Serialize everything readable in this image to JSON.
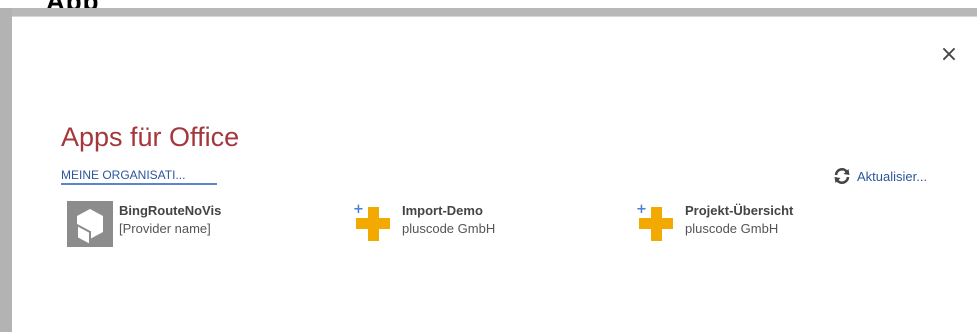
{
  "window": {
    "top_fragment": "App"
  },
  "dialog": {
    "close_label": "×",
    "title": "Apps für Office",
    "tab_label": "MEINE ORGANISATI...",
    "refresh_label": "Aktualisier...",
    "apps": [
      {
        "name": "BingRouteNoVis",
        "provider": "[Provider name]",
        "icon": "gray-app-tile-icon"
      },
      {
        "name": "Import-Demo",
        "provider": "pluscode GmbH",
        "icon": "plus-addin-icon"
      },
      {
        "name": "Projekt-Übersicht",
        "provider": "pluscode GmbH",
        "icon": "plus-addin-icon"
      }
    ]
  },
  "colors": {
    "title": "#a4373a",
    "link": "#2b579a",
    "tab_underline": "#5b87c9",
    "addin_orange": "#f2a900",
    "addin_blue": "#4a7fd4"
  }
}
